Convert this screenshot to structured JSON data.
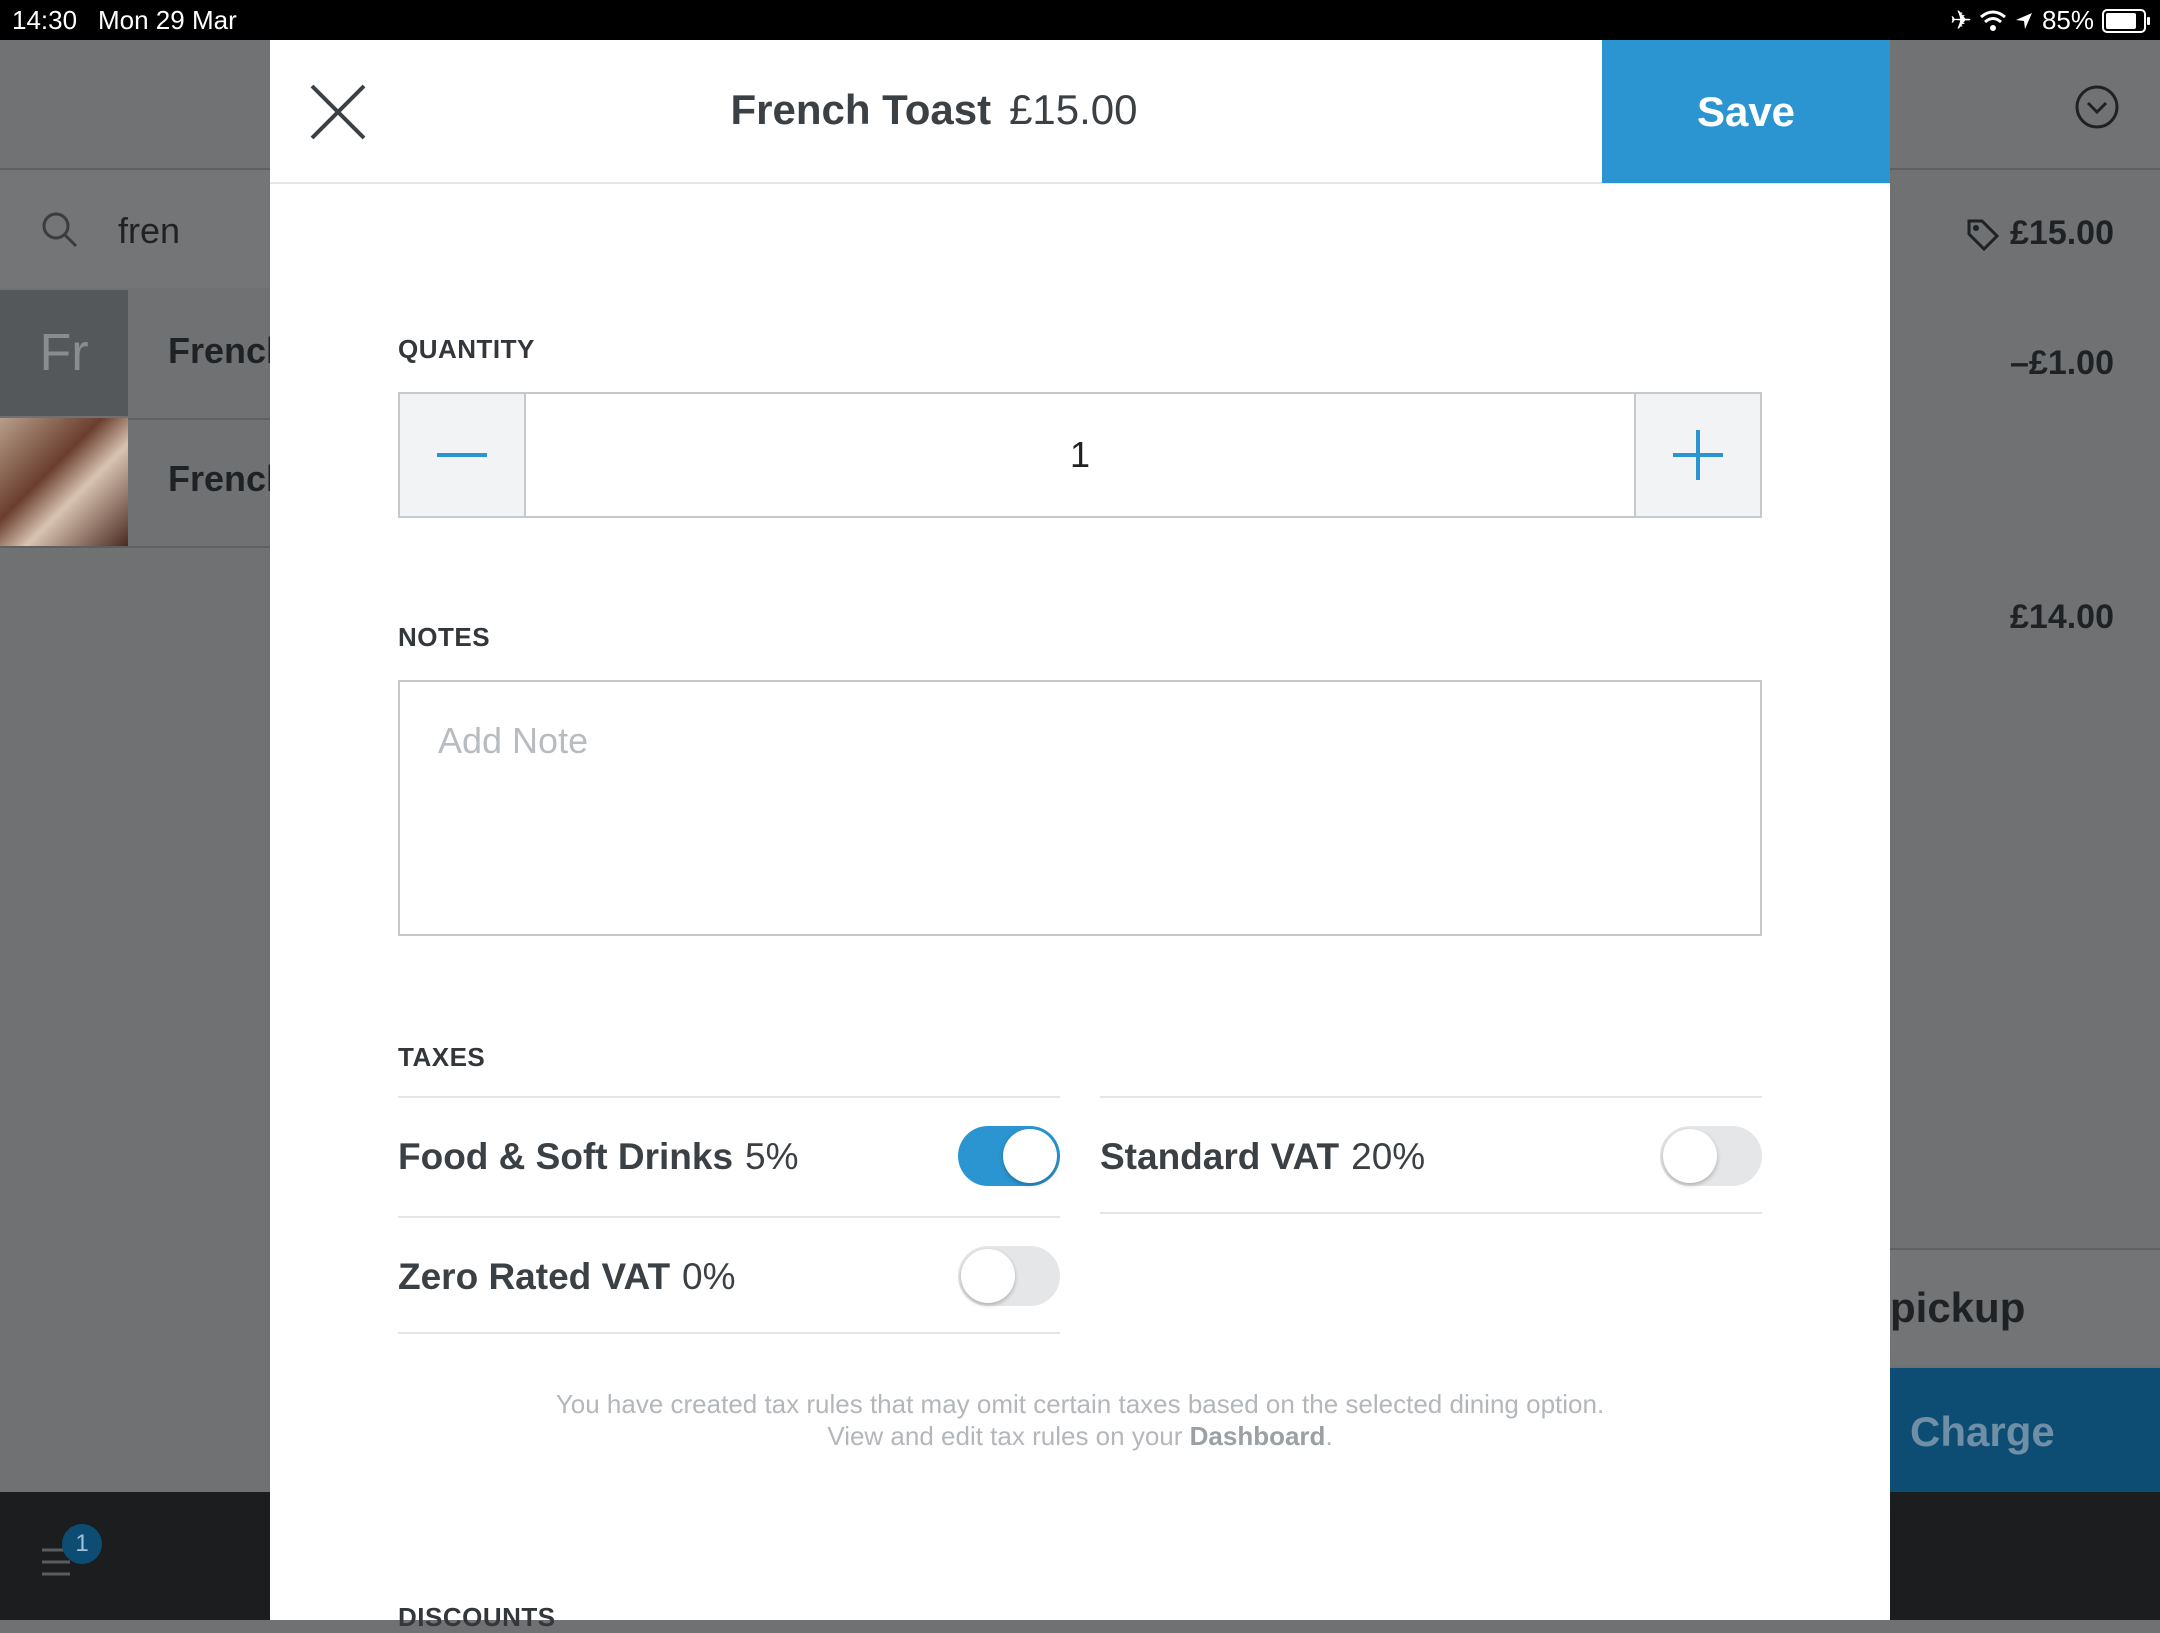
{
  "status_bar": {
    "time": "14:30",
    "date": "Mon 29 Mar",
    "battery": "85%",
    "icons": [
      "airplane-icon",
      "wifi-icon",
      "location-icon",
      "battery-icon"
    ]
  },
  "background": {
    "search_query": "fren",
    "items": [
      {
        "thumb_text": "Fr",
        "name": "Frencl"
      },
      {
        "thumb_text": "",
        "name": "Frencl"
      }
    ],
    "prices": [
      "£15.00",
      "–£1.00",
      "£14.00"
    ],
    "pickup_label": "pickup",
    "charge_label": "Charge",
    "badge_count": "1"
  },
  "modal": {
    "title": "French Toast",
    "price": "£15.00",
    "save_label": "Save",
    "quantity": {
      "label": "QUANTITY",
      "value": "1"
    },
    "notes": {
      "label": "NOTES",
      "placeholder": "Add Note"
    },
    "taxes": {
      "label": "TAXES",
      "items": [
        {
          "name": "Food & Soft Drinks",
          "rate": "5%",
          "enabled": true
        },
        {
          "name": "Standard VAT",
          "rate": "20%",
          "enabled": false
        },
        {
          "name": "Zero Rated VAT",
          "rate": "0%",
          "enabled": false
        }
      ],
      "info_line1": "You have created tax rules that may omit certain taxes based on the selected dining option.",
      "info_line2_prefix": "View and edit tax rules on your",
      "info_link": "Dashboard",
      "info_suffix": "."
    },
    "discounts": {
      "label": "DISCOUNTS"
    }
  },
  "colors": {
    "accent": "#2b95d1",
    "charge": "#0e4d73",
    "text": "#3b4045"
  }
}
